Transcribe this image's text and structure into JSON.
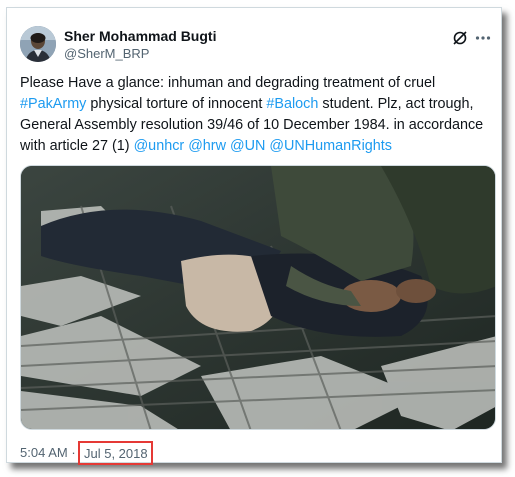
{
  "author": {
    "display_name": "Sher Mohammad Bugti",
    "handle": "@SherM_BRP"
  },
  "tweet": {
    "lines": [
      [
        {
          "t": "Please Have a glance: inhuman and degrading treatment of cruel",
          "link": false
        }
      ],
      [
        {
          "t": "#PakArmy",
          "link": true
        },
        {
          "t": " physical torture of innocent ",
          "link": false
        },
        {
          "t": "#Baloch",
          "link": true
        },
        {
          "t": " student. Plz, act trough,",
          "link": false
        }
      ],
      [
        {
          "t": "General Assembly resolution 39/46 of 10 December 1984. in accordance",
          "link": false
        }
      ],
      [
        {
          "t": "with article 27 (1) ",
          "link": false
        },
        {
          "t": "@unhcr",
          "link": true
        },
        {
          "t": " ",
          "link": false
        },
        {
          "t": "@hrw",
          "link": true
        },
        {
          "t": " ",
          "link": false
        },
        {
          "t": "@UN",
          "link": true
        },
        {
          "t": " ",
          "link": false
        },
        {
          "t": "@UNHumanRights",
          "link": true
        }
      ]
    ]
  },
  "timestamp": {
    "time": "5:04 AM",
    "separator": "·",
    "date": "Jul 5, 2018"
  },
  "icons": {
    "grok": "grok-icon",
    "more": "more-icon",
    "avatar": "avatar"
  },
  "colors": {
    "link": "#1d9bf0",
    "text": "#0f1419",
    "muted": "#536471",
    "highlight_box": "#e53935"
  }
}
